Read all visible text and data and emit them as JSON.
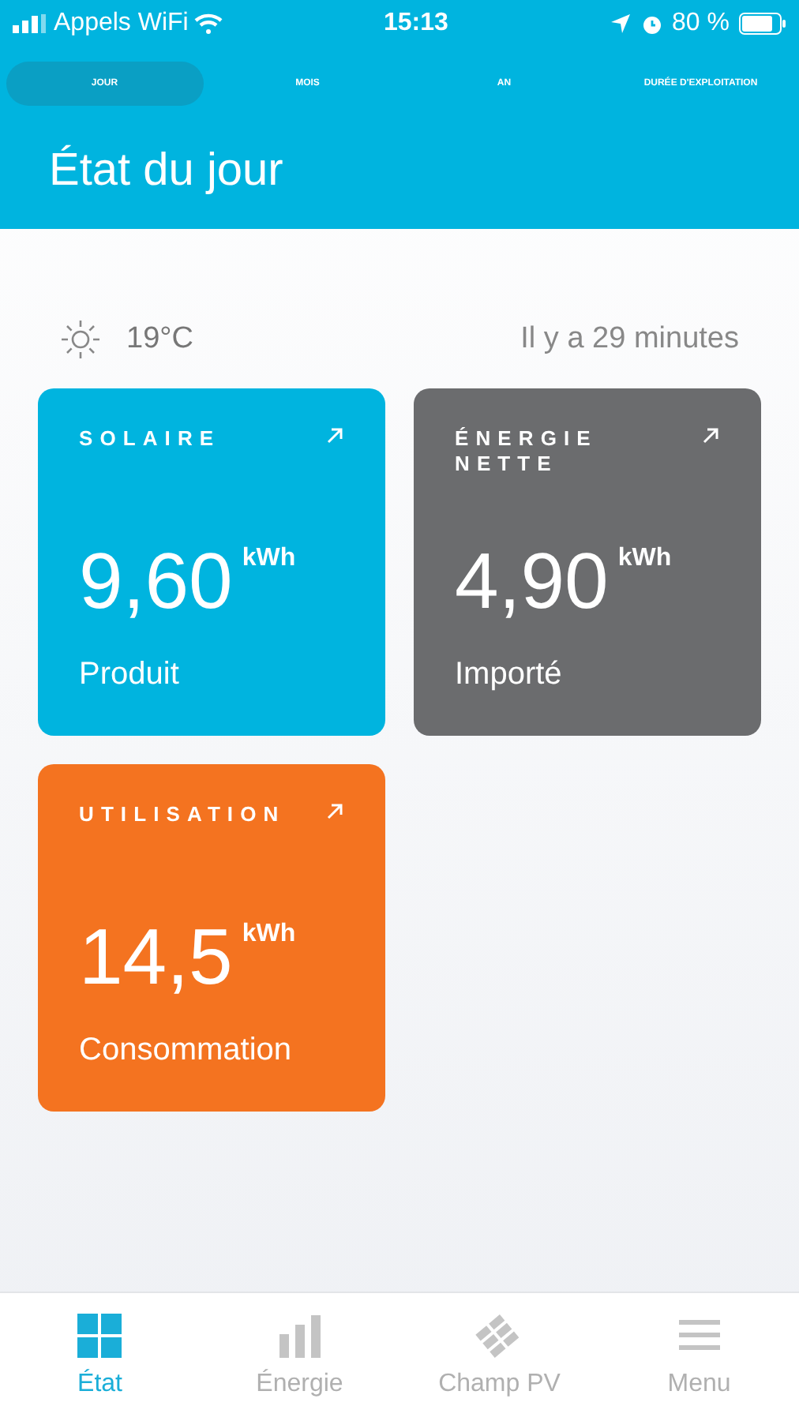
{
  "status_bar": {
    "carrier": "Appels WiFi",
    "time": "15:13",
    "battery": "80 %"
  },
  "period_tabs": [
    {
      "label": "JOUR",
      "selected": true
    },
    {
      "label": "MOIS",
      "selected": false
    },
    {
      "label": "AN",
      "selected": false
    },
    {
      "label": "DURÉE D'EXPLOITATION",
      "selected": false
    }
  ],
  "title": "État du jour",
  "weather": {
    "temperature": "19°C",
    "updated": "Il y a 29 minutes"
  },
  "cards": [
    {
      "title": "SOLAIRE",
      "value": "9,60",
      "unit": "kWh",
      "caption": "Produit",
      "color": "#00b4df"
    },
    {
      "title": "ÉNERGIE NETTE",
      "value": "4,90",
      "unit": "kWh",
      "caption": "Importé",
      "color": "#6b6c6e"
    },
    {
      "title": "UTILISATION",
      "value": "14,5",
      "unit": "kWh",
      "caption": "Consommation",
      "color": "#f47320"
    }
  ],
  "bottom_nav": [
    {
      "label": "État",
      "kind": "grid",
      "selected": true
    },
    {
      "label": "Énergie",
      "kind": "bars",
      "selected": false
    },
    {
      "label": "Champ PV",
      "kind": "panels",
      "selected": false
    },
    {
      "label": "Menu",
      "kind": "menu",
      "selected": false
    }
  ]
}
